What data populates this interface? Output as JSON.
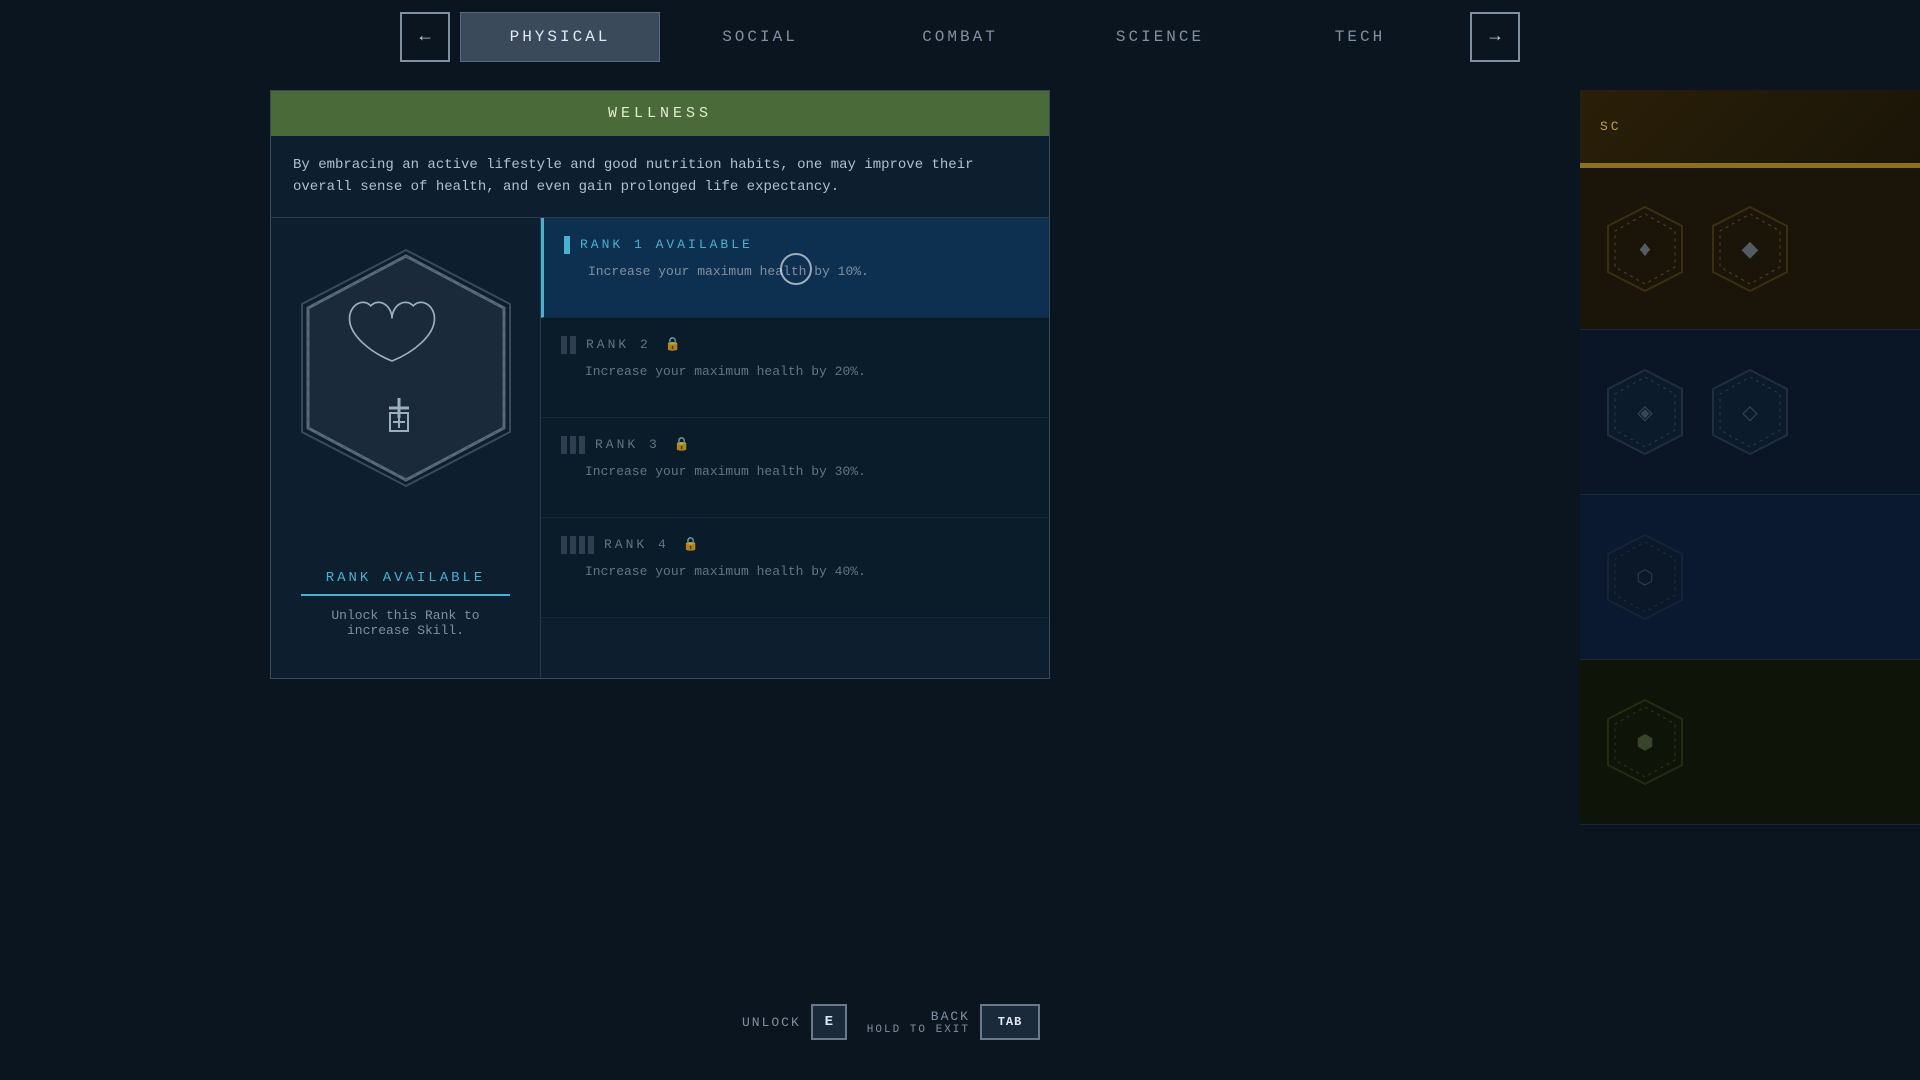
{
  "nav": {
    "tabs": [
      {
        "id": "physical",
        "label": "PHYSICAL",
        "active": true
      },
      {
        "id": "social",
        "label": "SOCIAL",
        "active": false
      },
      {
        "id": "combat",
        "label": "COMBAT",
        "active": false
      },
      {
        "id": "science",
        "label": "SCIENCE",
        "active": false
      },
      {
        "id": "tech",
        "label": "TECH",
        "active": false
      }
    ],
    "prev_arrow": "←",
    "next_arrow": "→"
  },
  "skill": {
    "header": "WELLNESS",
    "description": "By embracing an active lifestyle and good nutrition habits, one may improve their overall sense of health, and even gain prolonged life expectancy.",
    "status_label": "RANK AVAILABLE",
    "status_description": "Unlock this Rank to increase Skill.",
    "ranks": [
      {
        "id": 1,
        "label": "RANK 1 AVAILABLE",
        "description": "Increase your maximum health by 10%.",
        "available": true,
        "locked": false,
        "bars": 1
      },
      {
        "id": 2,
        "label": "RANK 2",
        "description": "Increase your maximum health by 20%.",
        "available": false,
        "locked": true,
        "bars": 2
      },
      {
        "id": 3,
        "label": "RANK 3",
        "description": "Increase your maximum health by 30%.",
        "available": false,
        "locked": true,
        "bars": 3
      },
      {
        "id": 4,
        "label": "RANK 4",
        "description": "Increase your maximum health by 40%.",
        "available": false,
        "locked": true,
        "bars": 4
      }
    ]
  },
  "actions": {
    "unlock_label": "UNLOCK",
    "unlock_key": "E",
    "back_label": "BACK",
    "hold_to_exit_label": "HOLD TO EXIT",
    "back_key": "TAB"
  },
  "sidebar": {
    "label": "SC",
    "sections": [
      {
        "tint": "gold-tint",
        "badges": 2
      },
      {
        "tint": "teal-tint",
        "badges": 2
      },
      {
        "tint": "dark-teal",
        "badges": 1
      },
      {
        "tint": "olive-tint",
        "badges": 1
      }
    ]
  }
}
